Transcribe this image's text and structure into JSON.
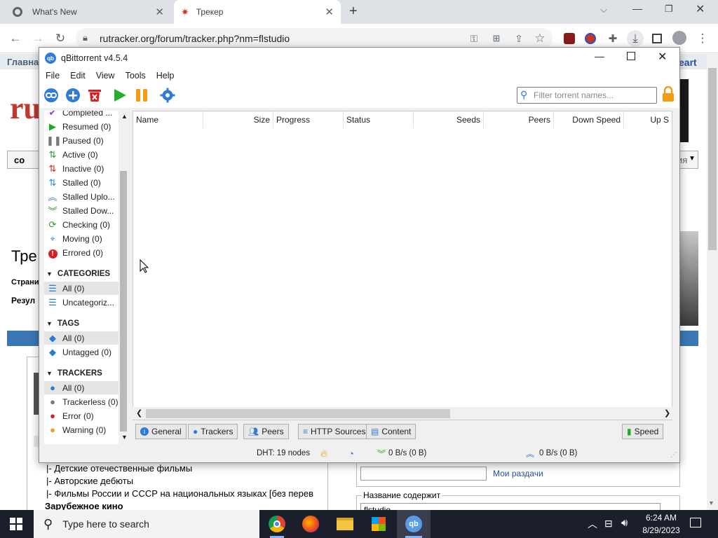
{
  "browser": {
    "tabs": [
      {
        "title": "What's New"
      },
      {
        "title": "Трекер"
      }
    ],
    "new_tab": "+",
    "url": "rutracker.org/forum/tracker.php?nm=flstudio"
  },
  "bg_page": {
    "nav_left": "Главна",
    "nav_right": "eart",
    "logo": "ru",
    "btn_label": "со",
    "dropdown": "ия",
    "heading": "Тре",
    "pages_label": "Страни",
    "results_label": "Резул",
    "list": [
      "|- Детские отечественные фильмы",
      "|- Авторские дебюты",
      "|- Фильмы России и СССР на национальных языках [без перев"
    ],
    "section": "Зарубежное кино",
    "my_distrib": "Мои раздачи",
    "content_name_label": "Название содержит",
    "search_value": "flstudio"
  },
  "qbt": {
    "title": "qBittorrent v4.5.4",
    "menu": [
      "File",
      "Edit",
      "View",
      "Tools",
      "Help"
    ],
    "filter_placeholder": "Filter torrent names...",
    "status_items": [
      {
        "label": "Completed ...",
        "color": "#8a3fd1"
      },
      {
        "label": "Resumed (0)",
        "color": "#22a822"
      },
      {
        "label": "Paused (0)",
        "color": "#777777"
      },
      {
        "label": "Active (0)",
        "color": "#2a9a2a"
      },
      {
        "label": "Inactive (0)",
        "color": "#d42020"
      },
      {
        "label": "Stalled (0)",
        "color": "#2a8ad2"
      },
      {
        "label": "Stalled Uplo...",
        "color": "#3a7ad2"
      },
      {
        "label": "Stalled Dow...",
        "color": "#2a9a2a"
      },
      {
        "label": "Checking (0)",
        "color": "#2a9a2a"
      },
      {
        "label": "Moving (0)",
        "color": "#2a8ad2"
      },
      {
        "label": "Errored (0)",
        "color": "#d42020"
      }
    ],
    "categories": {
      "heading": "CATEGORIES",
      "items": [
        "All (0)",
        "Uncategoriz..."
      ]
    },
    "tags": {
      "heading": "TAGS",
      "items": [
        "All (0)",
        "Untagged (0)"
      ]
    },
    "trackers": {
      "heading": "TRACKERS",
      "items": [
        "All (0)",
        "Trackerless (0)",
        "Error (0)",
        "Warning (0)"
      ]
    },
    "columns": [
      "Name",
      "Size",
      "Progress",
      "Status",
      "Seeds",
      "Peers",
      "Down Speed",
      "Up S"
    ],
    "props_tabs": [
      "General",
      "Trackers",
      "Peers",
      "HTTP Sources",
      "Content"
    ],
    "speed_tab": "Speed",
    "statusbar": {
      "dht": "DHT: 19 nodes",
      "down": "0 B/s (0 B)",
      "up": "0 B/s (0 B)"
    }
  },
  "taskbar": {
    "search_placeholder": "Type here to search",
    "time": "6:24 AM",
    "date": "8/29/2023"
  }
}
